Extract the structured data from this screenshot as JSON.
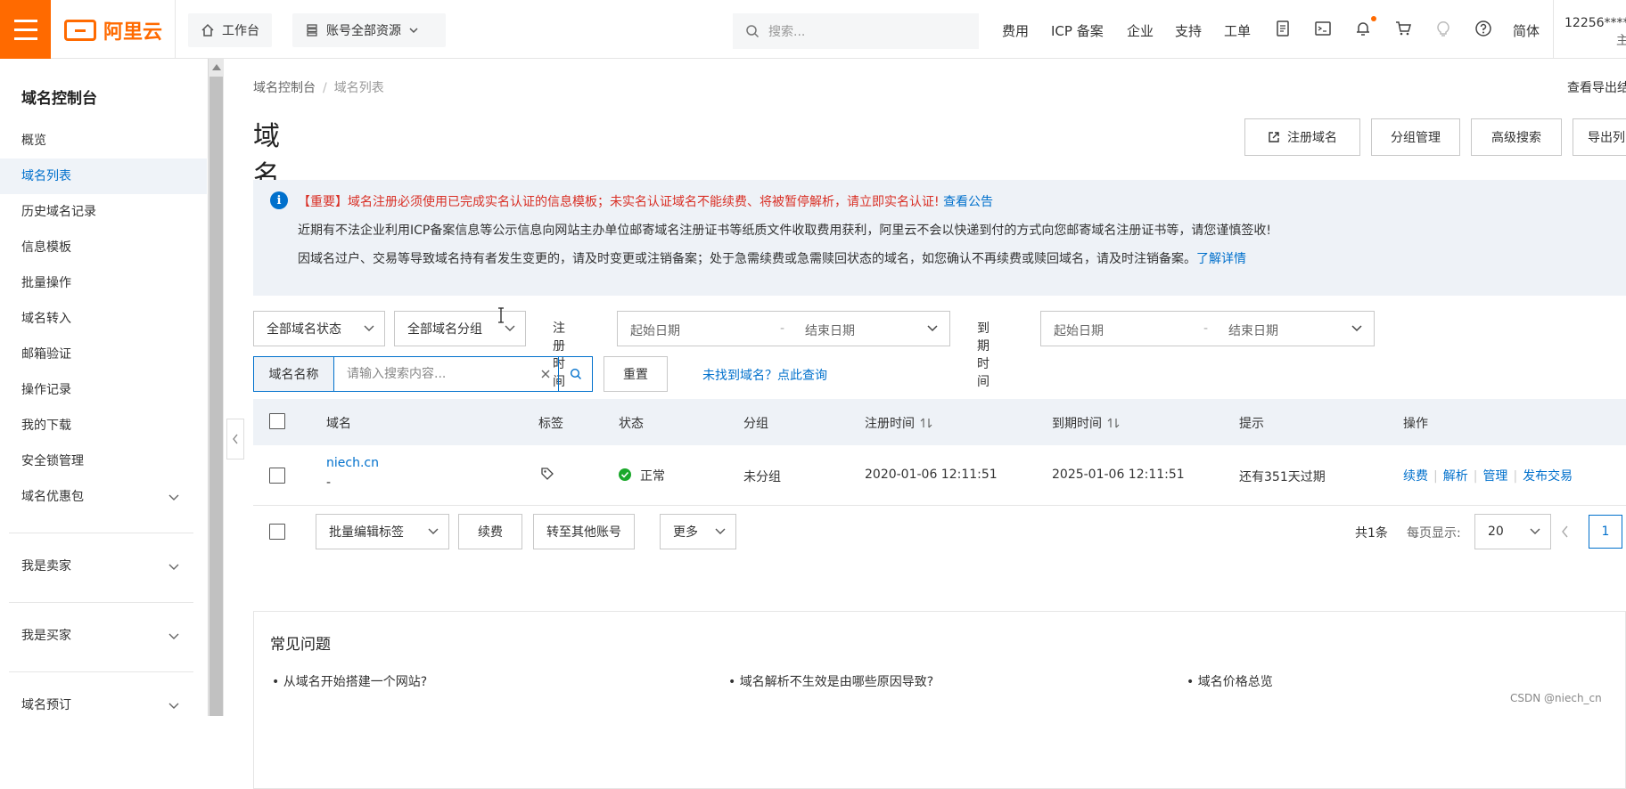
{
  "header": {
    "logo_text": "阿里云",
    "workbench_label": "工作台",
    "resources_label": "账号全部资源",
    "search_placeholder": "搜索...",
    "nav_items": [
      "费用",
      "ICP 备案",
      "企业",
      "支持",
      "工单"
    ],
    "lang_label": "简体",
    "user_line1": "12256*****",
    "user_line2": "主",
    "brand_color": "#ff6a00"
  },
  "sidebar": {
    "title": "域名控制台",
    "items": [
      {
        "label": "概览"
      },
      {
        "label": "域名列表",
        "active": true
      },
      {
        "label": "历史域名记录"
      },
      {
        "label": "信息模板"
      },
      {
        "label": "批量操作"
      },
      {
        "label": "域名转入"
      },
      {
        "label": "邮箱验证"
      },
      {
        "label": "操作记录"
      },
      {
        "label": "我的下载"
      },
      {
        "label": "安全锁管理"
      },
      {
        "label": "域名优惠包",
        "expandable": true
      }
    ],
    "sections": [
      "我是卖家",
      "我是买家",
      "域名预订"
    ]
  },
  "main": {
    "breadcrumb": [
      "域名控制台",
      "域名列表"
    ],
    "page_title": "域名列表",
    "export_link": "查看导出结",
    "header_buttons": [
      "注册域名",
      "分组管理",
      "高级搜索",
      "导出列"
    ],
    "notice": {
      "line1": "【重要】域名注册必须使用已完成实名认证的信息模板；未实名认证域名不能续费、将被暂停解析，请立即实名认证!",
      "line1_link": "查看公告",
      "line2": "近期有不法企业利用ICP备案信息等公示信息向网站主办单位邮寄域名注册证书等纸质文件收取费用获利，阿里云不会以快递到付的方式向您邮寄域名注册证书等，请您谨慎签收!",
      "line3": "因域名过户、交易等导致域名持有者发生变更的，请及时变更或注销备案；处于急需续费或急需赎回状态的域名，如您确认不再续费或赎回域名，请及时注销备案。",
      "line3_link": "了解详情"
    },
    "filters": {
      "status": "全部域名状态",
      "group": "全部域名分组",
      "reg_time_label": "注册时间",
      "exp_time_label": "到期时间",
      "start_placeholder": "起始日期",
      "end_placeholder": "结束日期",
      "date_sep": "-",
      "search_label": "域名名称",
      "search_placeholder": "请输入搜索内容...",
      "reset": "重置",
      "not_found_link": "未找到域名？点此查询"
    },
    "table": {
      "columns": [
        "域名",
        "标签",
        "状态",
        "分组",
        "注册时间",
        "到期时间",
        "提示",
        "操作"
      ],
      "rows": [
        {
          "domain": "niech.cn",
          "sub": "-",
          "status": "正常",
          "group": "未分组",
          "reg_time": "2020-01-06 12:11:51",
          "exp_time": "2025-01-06 12:11:51",
          "tip": "还有351天过期",
          "ops": [
            "续费",
            "解析",
            "管理",
            "发布交易"
          ]
        }
      ]
    },
    "bulk": {
      "edit_tags": "批量编辑标签",
      "renew": "续费",
      "transfer": "转至其他账号",
      "more": "更多"
    },
    "pagination": {
      "total": "共1条",
      "page_size_label": "每页显示:",
      "page_size": "20",
      "current_page": "1"
    },
    "faq": {
      "title": "常见问题",
      "items": [
        "从域名开始搭建一个网站?",
        "域名解析不生效是由哪些原因导致?",
        "域名价格总览"
      ]
    }
  },
  "watermark": "CSDN @niech_cn",
  "colors": {
    "link": "#0070cc",
    "success": "#1aa82a",
    "danger": "#d93026"
  }
}
